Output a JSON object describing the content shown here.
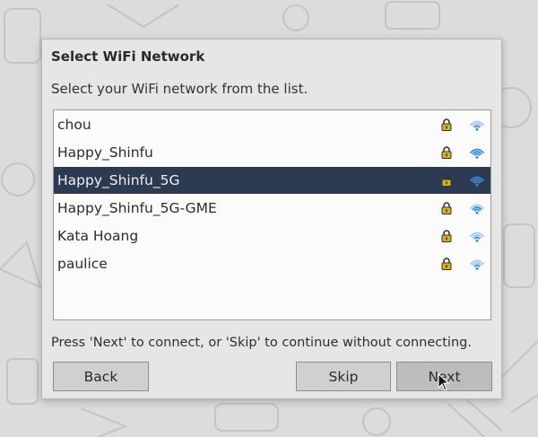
{
  "dialog": {
    "title": "Select WiFi Network",
    "subtitle": "Select your WiFi network from the list.",
    "hint": "Press 'Next' to connect, or 'Skip' to continue without connecting."
  },
  "networks": [
    {
      "ssid": "chou",
      "secured": true,
      "signal": "weak"
    },
    {
      "ssid": "Happy_Shinfu",
      "secured": true,
      "signal": "strong"
    },
    {
      "ssid": "Happy_Shinfu_5G",
      "secured": true,
      "signal": "strong",
      "selected": true
    },
    {
      "ssid": "Happy_Shinfu_5G-GME",
      "secured": true,
      "signal": "medium"
    },
    {
      "ssid": "Kata Hoang",
      "secured": true,
      "signal": "weak"
    },
    {
      "ssid": "paulice",
      "secured": true,
      "signal": "weak"
    }
  ],
  "buttons": {
    "back": "Back",
    "skip": "Skip",
    "next": "Next"
  },
  "colors": {
    "selected_row": "#2c3a52",
    "lock": "#d8b21a",
    "wifi_strong": "#3a8ad8",
    "wifi_weak": "#a9c7e6"
  },
  "icons": {
    "lock": "padlock-icon",
    "signal": "wifi-signal-icon",
    "pointer": "mouse-cursor-icon"
  }
}
